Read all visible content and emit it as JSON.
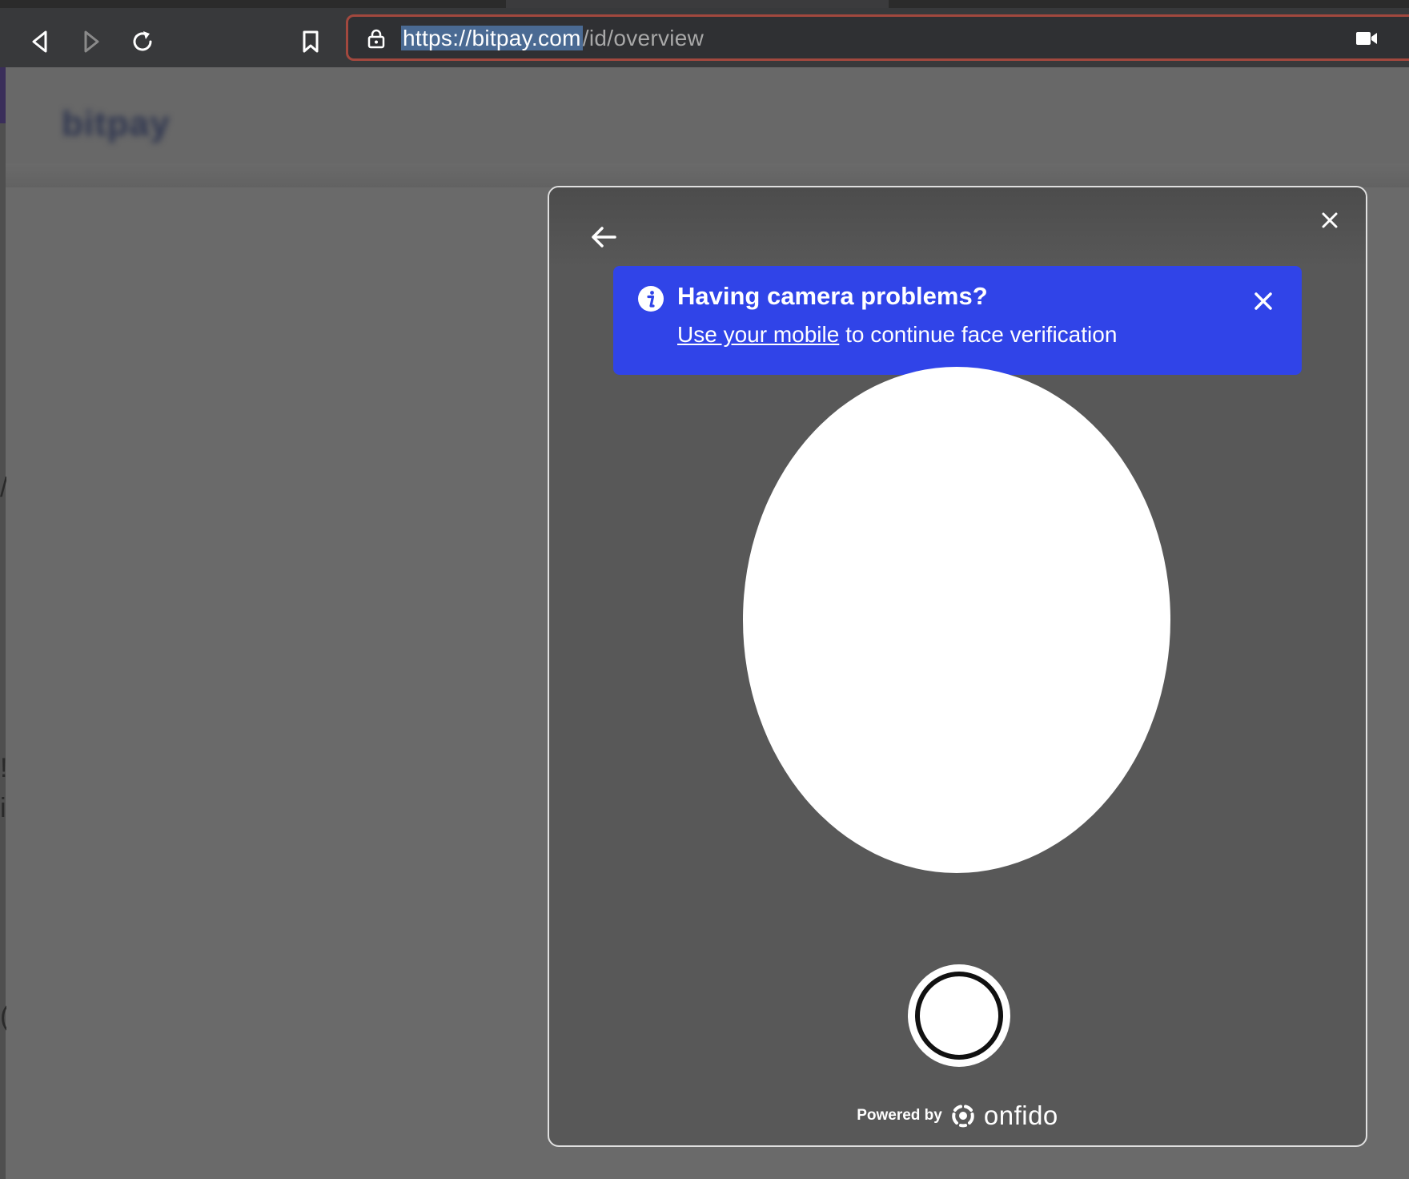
{
  "browser": {
    "url_host": "https://bitpay.com",
    "url_path": "/id/overview"
  },
  "background_page": {
    "logo": "bitpay"
  },
  "modal": {
    "banner": {
      "title": "Having camera problems?",
      "link_text": "Use your mobile",
      "body_suffix": " to continue face verification"
    },
    "footer": {
      "powered_by": "Powered by",
      "brand": "onfido"
    }
  },
  "colors": {
    "banner_bg": "#3044e8",
    "modal_bg": "#585858",
    "overlay_bg": "#6a6a6a",
    "url_border": "#a2483e"
  },
  "icons": {
    "back": "arrow-left-icon",
    "forward": "arrow-right-icon",
    "reload": "reload-icon",
    "bookmark": "bookmark-icon",
    "lock": "lock-icon",
    "camera": "camera-icon",
    "close": "close-icon",
    "info": "info-icon"
  }
}
